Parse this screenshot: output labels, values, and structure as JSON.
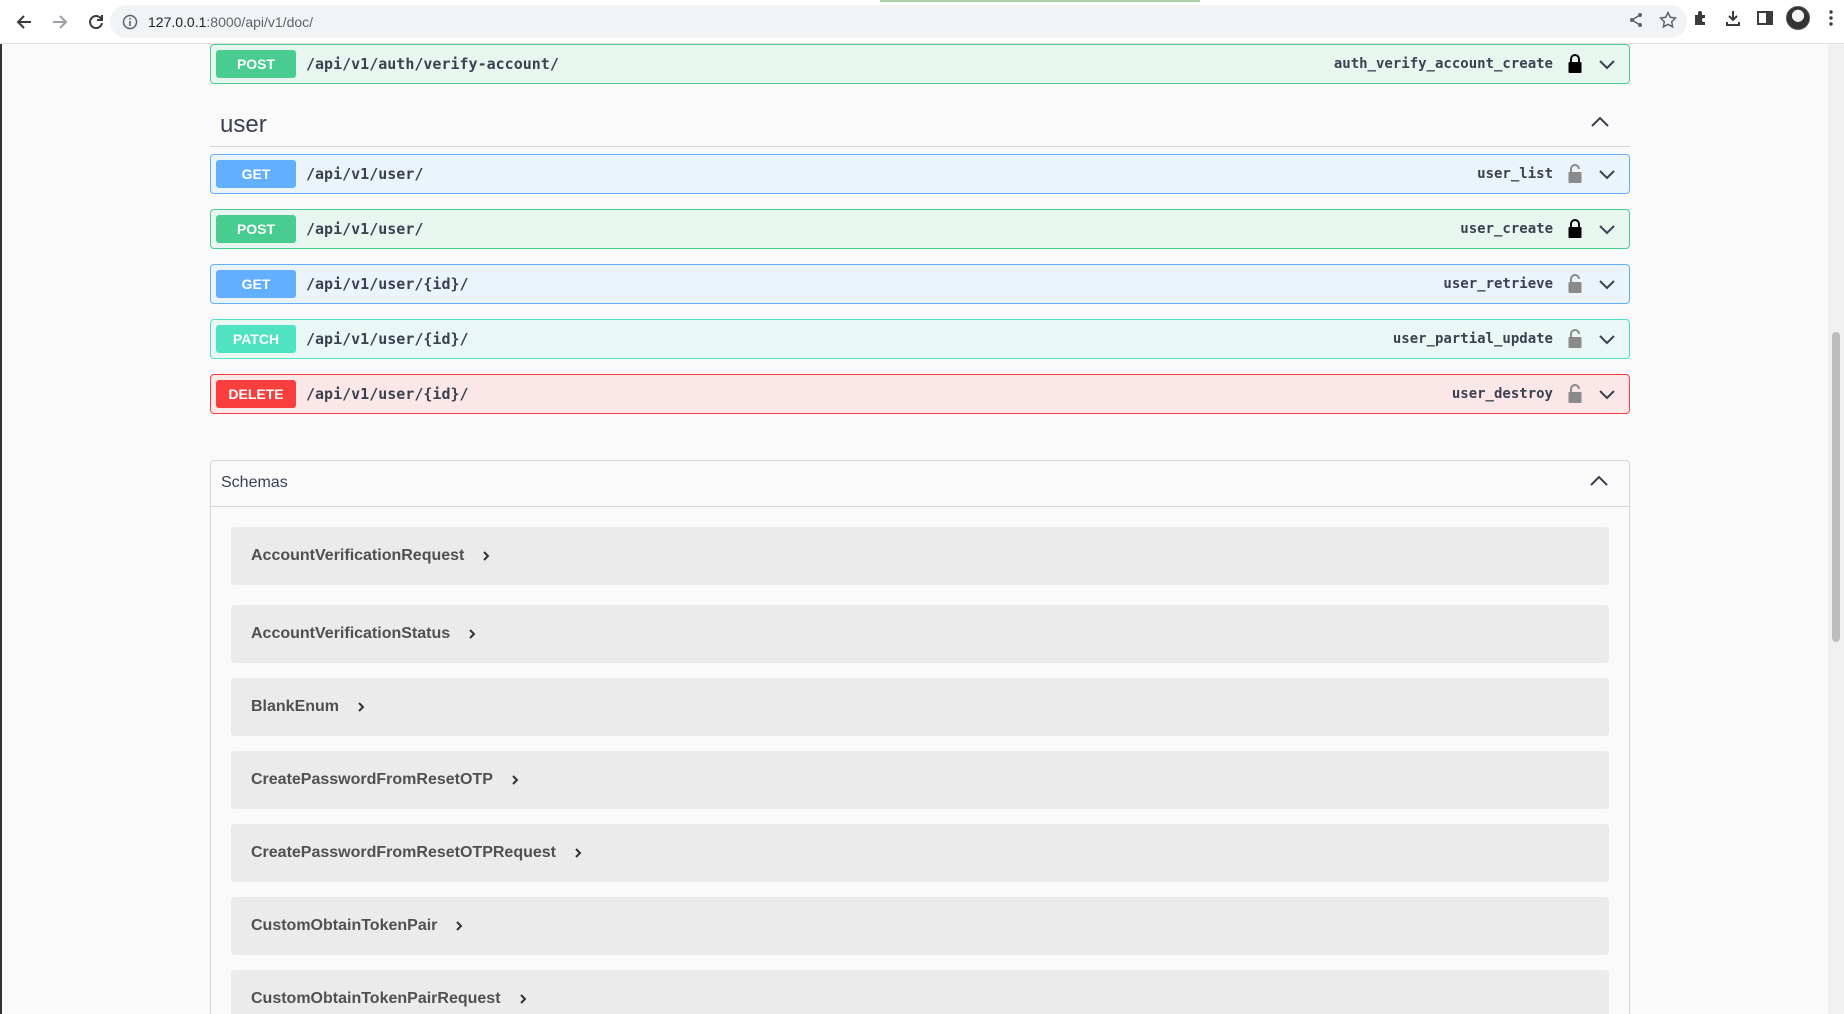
{
  "browser": {
    "url_host": "127.0.0.1",
    "url_rest": ":8000/api/v1/doc/"
  },
  "top_operation": {
    "method": "POST",
    "path": "/api/v1/auth/verify-account/",
    "operation_id": "auth_verify_account_create"
  },
  "tag": {
    "title": "user"
  },
  "operations": [
    {
      "method": "GET",
      "path": "/api/v1/user/",
      "operation_id": "user_list"
    },
    {
      "method": "POST",
      "path": "/api/v1/user/",
      "operation_id": "user_create"
    },
    {
      "method": "GET",
      "path": "/api/v1/user/{id}/",
      "operation_id": "user_retrieve"
    },
    {
      "method": "PATCH",
      "path": "/api/v1/user/{id}/",
      "operation_id": "user_partial_update"
    },
    {
      "method": "DELETE",
      "path": "/api/v1/user/{id}/",
      "operation_id": "user_destroy"
    }
  ],
  "schemas": {
    "title": "Schemas",
    "models": [
      "AccountVerificationRequest",
      "AccountVerificationStatus",
      "BlankEnum",
      "CreatePasswordFromResetOTP",
      "CreatePasswordFromResetOTPRequest",
      "CustomObtainTokenPair",
      "CustomObtainTokenPairRequest"
    ]
  },
  "colors": {
    "post": "#49cc90",
    "get": "#61affe",
    "patch": "#50e3c2",
    "delete": "#f93e3e"
  }
}
